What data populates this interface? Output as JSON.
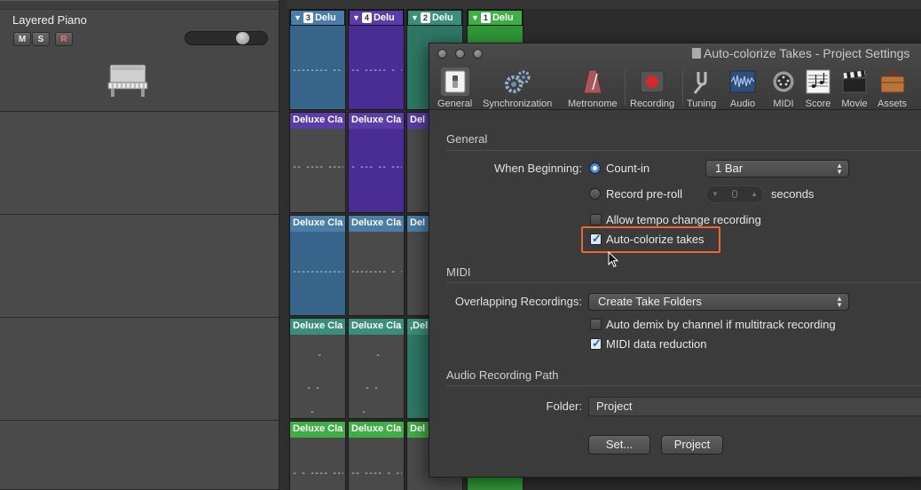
{
  "track": {
    "name": "Layered Piano",
    "mute_label": "M",
    "solo_label": "S",
    "record_label": "R",
    "icon": "upright-piano-icon"
  },
  "takes": {
    "folders": [
      {
        "number": "3",
        "name": "Delu",
        "color": "#4a7da8"
      },
      {
        "number": "4",
        "name": "Delu",
        "color": "#5b3ca8"
      },
      {
        "number": "2",
        "name": "Delu",
        "color": "#3a8f7a"
      },
      {
        "number": "1",
        "name": "Delu",
        "color": "#3fae45"
      }
    ],
    "region_label_full": "Deluxe Cla",
    "region_label_partial": "Delu",
    "region_label_clip": "Del",
    "region_label_teal": ",Deluxe Cla",
    "region_label_teal_short": ",Del"
  },
  "dialog": {
    "title": "Auto-colorize Takes - Project Settings",
    "toolbar": [
      {
        "label": "General",
        "icon": "general-switch-icon"
      },
      {
        "label": "Synchronization",
        "icon": "gears-icon"
      },
      {
        "label": "Metronome",
        "icon": "metronome-icon"
      },
      {
        "label": "Recording",
        "icon": "record-icon"
      },
      {
        "label": "Tuning",
        "icon": "tuning-fork-icon"
      },
      {
        "label": "Audio",
        "icon": "waveform-icon"
      },
      {
        "label": "MIDI",
        "icon": "midi-icon"
      },
      {
        "label": "Score",
        "icon": "score-icon"
      },
      {
        "label": "Movie",
        "icon": "clapperboard-icon"
      },
      {
        "label": "Assets",
        "icon": "briefcase-icon"
      }
    ],
    "general": {
      "section_title": "General",
      "when_beginning_label": "When Beginning:",
      "count_in_label": "Count-in",
      "count_in_value": "1 Bar",
      "preroll_label": "Record pre-roll",
      "preroll_value": "0",
      "seconds_label": "seconds",
      "tempo_label": "Allow tempo change recording",
      "autocolorize_label": "Auto-colorize takes"
    },
    "midi": {
      "section_title": "MIDI",
      "overlapping_label": "Overlapping Recordings:",
      "overlapping_value": "Create Take Folders",
      "demix_label": "Auto demix by channel if multitrack recording",
      "reduction_label": "MIDI data reduction"
    },
    "audio_path": {
      "section_title": "Audio Recording Path",
      "folder_label": "Folder:",
      "folder_value": "Project",
      "set_button": "Set...",
      "project_button": "Project"
    },
    "state": {
      "count_in_selected": true,
      "preroll_selected": false,
      "tempo_checked": false,
      "autocolorize_checked": true,
      "demix_checked": false,
      "reduction_checked": true
    }
  },
  "colors": {
    "highlight": "#e8692e",
    "accent": "#4a8be8"
  }
}
